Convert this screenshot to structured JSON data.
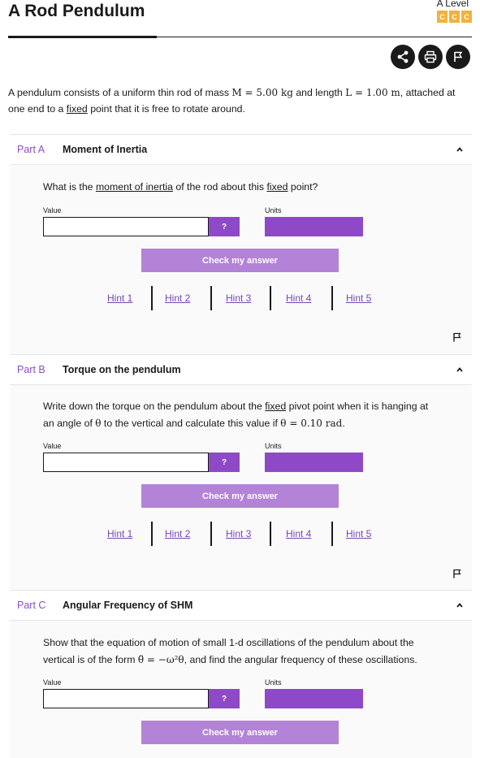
{
  "header": {
    "title": "A Rod Pendulum",
    "level": "A Level",
    "badges": [
      "C",
      "C",
      "C"
    ],
    "icons": [
      "share-icon",
      "print-icon",
      "flag-icon"
    ]
  },
  "intro": {
    "t1": "A pendulum consists of a uniform thin rod of mass ",
    "m1": "M = 5.00 kg",
    "t2": " and length ",
    "m2": "L = 1.00 m",
    "t3": ", attached at one end to a ",
    "fixed": "fixed",
    "t4": " point that it is free to rotate around."
  },
  "parts": [
    {
      "label": "Part A",
      "title": "Moment of Inertia",
      "q1": "What is the ",
      "q_link": "moment of inertia",
      "q2": " of the rod about this ",
      "q_fixed": "fixed",
      "q3": " point?",
      "value_label": "Value",
      "units_label": "Units",
      "help_label": "?",
      "check_label": "Check my answer",
      "hints": [
        "Hint 1",
        "Hint 2",
        "Hint 3",
        "Hint 4",
        "Hint 5"
      ]
    },
    {
      "label": "Part B",
      "title": "Torque on the pendulum",
      "q1": "Write down the torque on the pendulum about the ",
      "q_fixed": "fixed",
      "q2": " pivot point when it is hanging at an angle of ",
      "m1": "θ",
      "q3": " to the vertical and calculate this value if ",
      "m2": "θ = 0.10 rad",
      "q4": ".",
      "value_label": "Value",
      "units_label": "Units",
      "help_label": "?",
      "check_label": "Check my answer",
      "hints": [
        "Hint 1",
        "Hint 2",
        "Hint 3",
        "Hint 4",
        "Hint 5"
      ]
    },
    {
      "label": "Part C",
      "title": "Angular Frequency of SHM",
      "q1": "Show that the equation of motion of small 1-d oscillations of the pendulum about the vertical is of the form ",
      "m1": "θ̈ = −ω²θ",
      "q2": ", and find the angular frequency of these oscillations.",
      "value_label": "Value",
      "units_label": "Units",
      "help_label": "?",
      "check_label": "Check my answer"
    }
  ],
  "colors": {
    "accent": "#8e4ac6",
    "accent_light": "#b283d6",
    "badge": "#f2b23a",
    "text": "#1a1a1a"
  }
}
